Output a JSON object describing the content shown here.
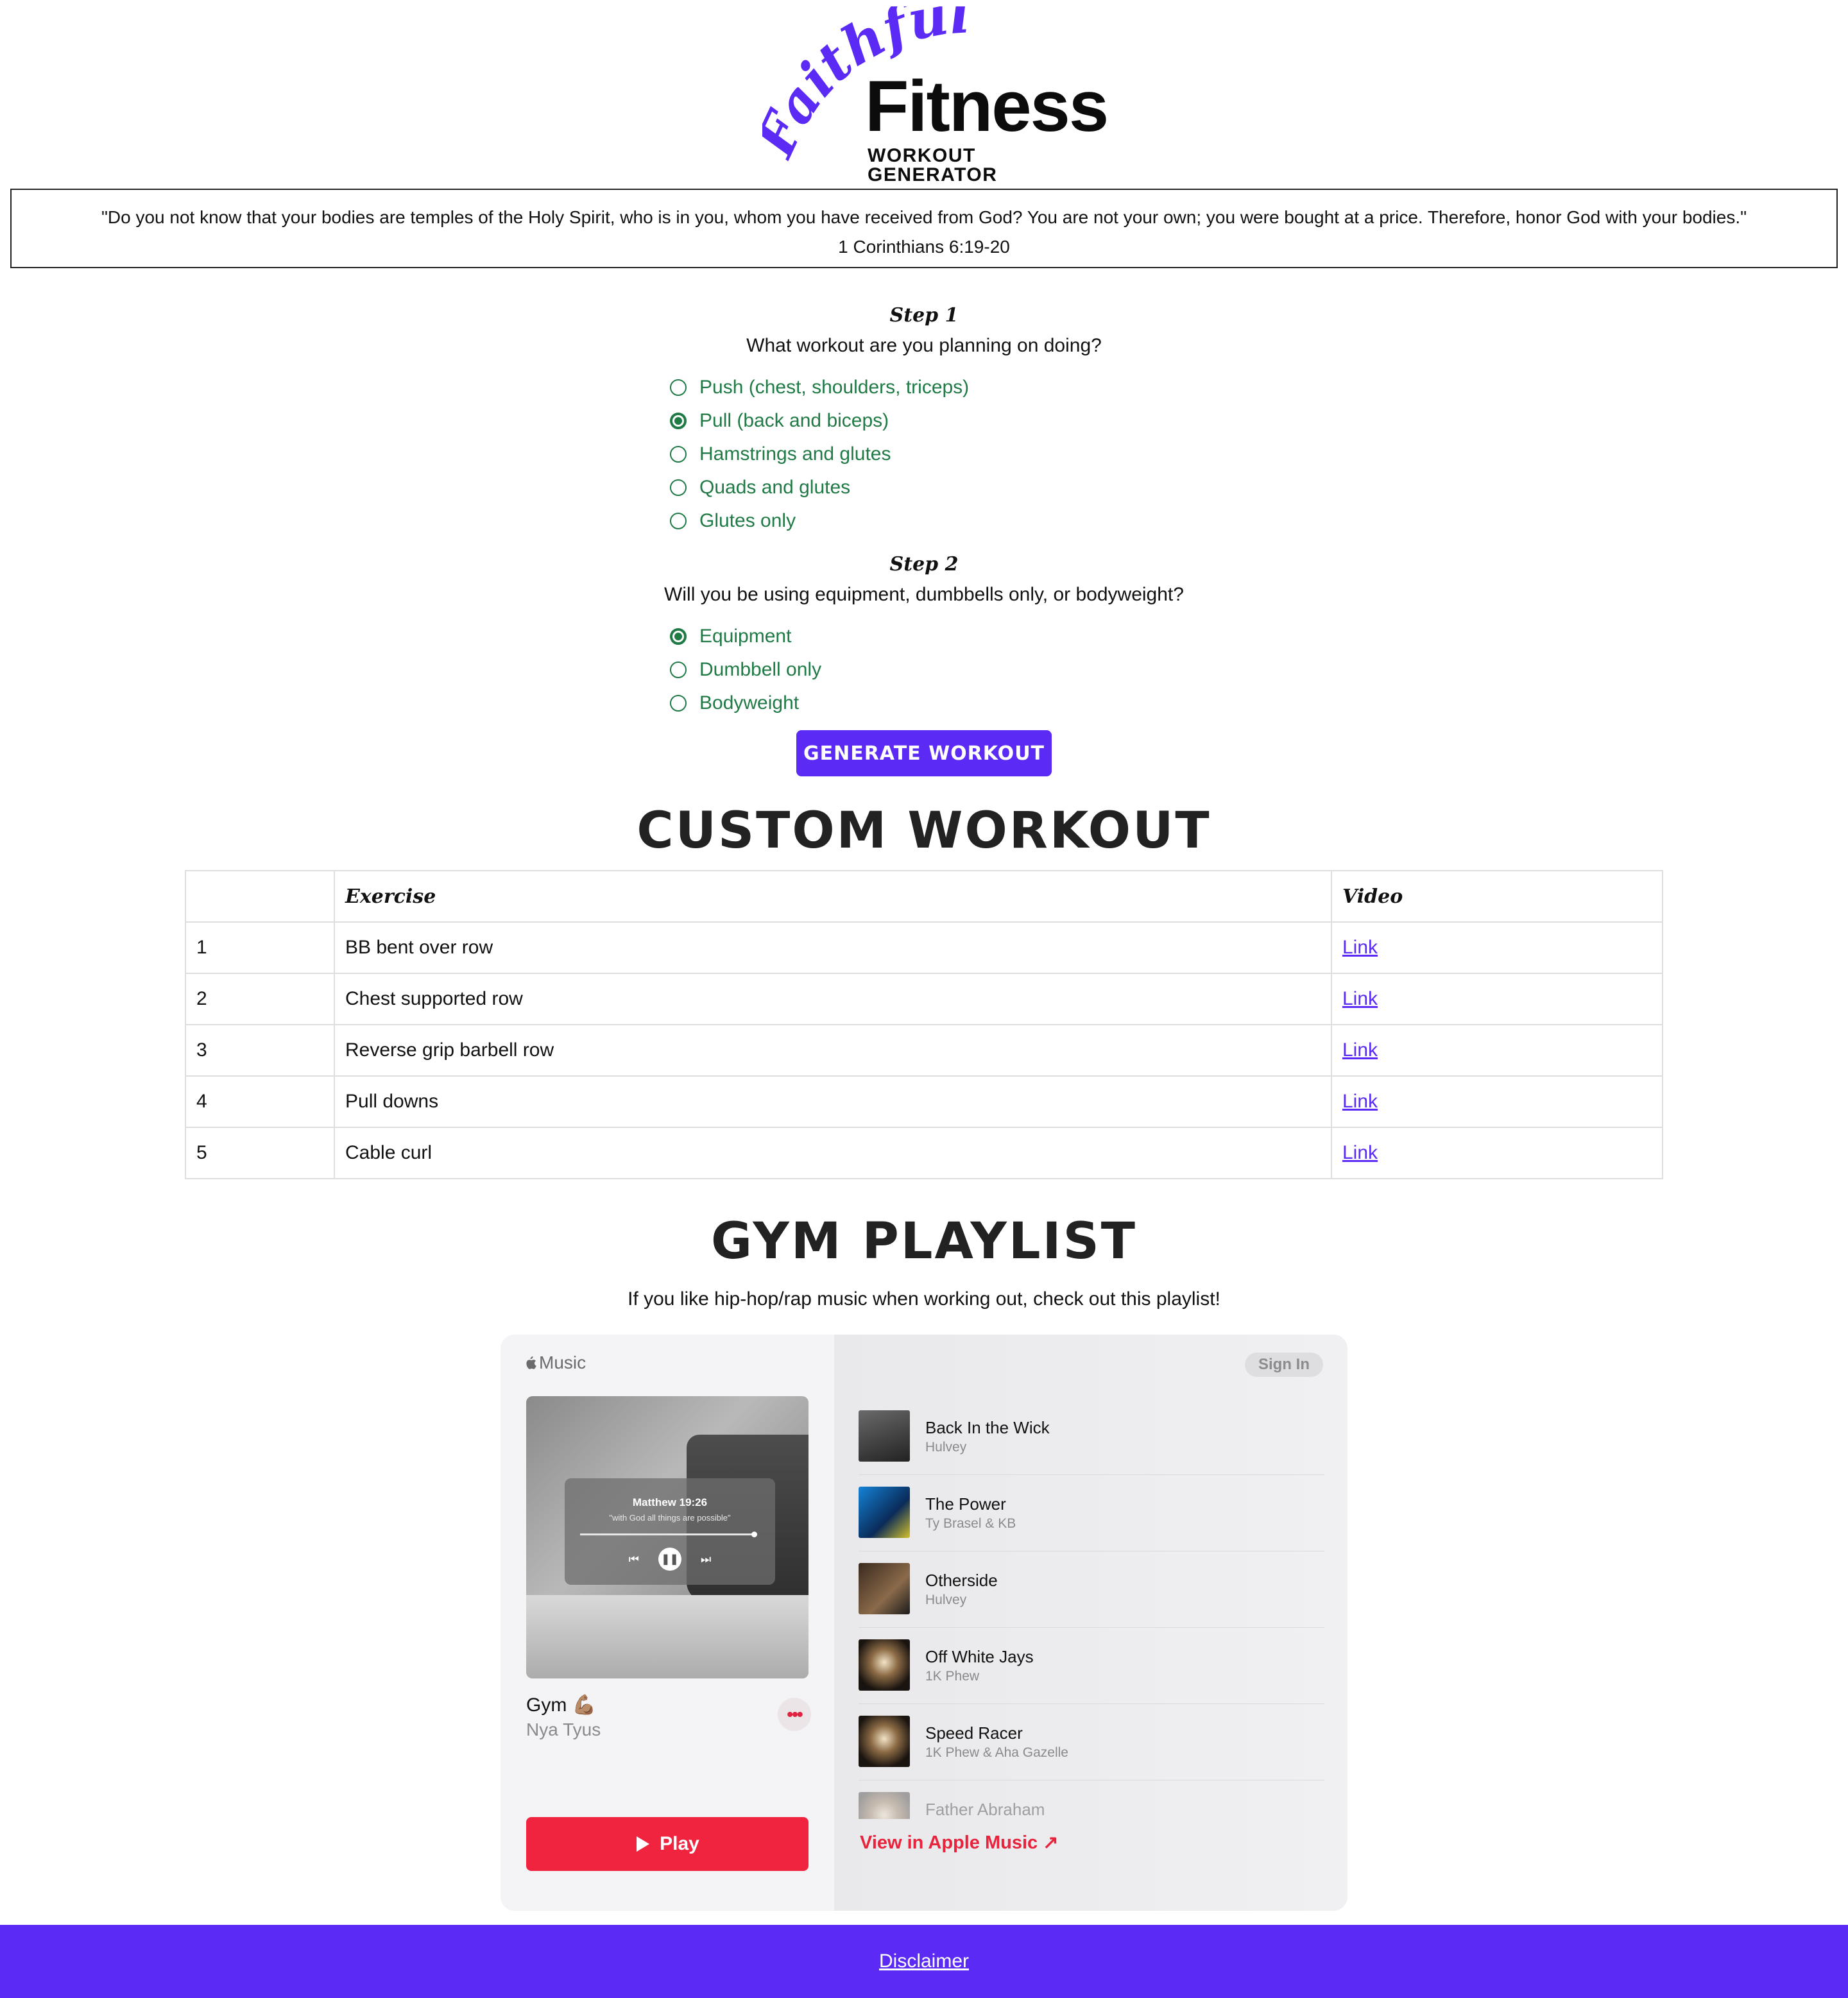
{
  "brand": {
    "script_word": "Faithful",
    "main_word": "Fitness",
    "subtitle": "WORKOUT GENERATOR",
    "accent_color": "#5b2bf5"
  },
  "verse": {
    "text": "\"Do you not know that your bodies are temples of the Holy Spirit, who is in you, whom you have received from God? You are not your own; you were bought at a price. Therefore, honor God with your bodies.\"",
    "reference": "1 Corinthians 6:19-20"
  },
  "step1": {
    "title": "Step 1",
    "question": "What workout are you planning on doing?",
    "options": [
      {
        "label": "Push (chest, shoulders, triceps)",
        "checked": false
      },
      {
        "label": "Pull (back and biceps)",
        "checked": true
      },
      {
        "label": "Hamstrings and glutes",
        "checked": false
      },
      {
        "label": "Quads and glutes",
        "checked": false
      },
      {
        "label": "Glutes only",
        "checked": false
      }
    ]
  },
  "step2": {
    "title": "Step 2",
    "question": "Will you be using equipment, dumbbells only, or bodyweight?",
    "options": [
      {
        "label": "Equipment",
        "checked": true
      },
      {
        "label": "Dumbbell only",
        "checked": false
      },
      {
        "label": "Bodyweight",
        "checked": false
      }
    ]
  },
  "generate_button": "Generate Workout",
  "workout": {
    "heading": "Custom Workout",
    "columns": [
      "",
      "Exercise",
      "Video"
    ],
    "rows": [
      {
        "num": "1",
        "exercise": "BB bent over row",
        "video": "Link"
      },
      {
        "num": "2",
        "exercise": "Chest supported row",
        "video": "Link"
      },
      {
        "num": "3",
        "exercise": "Reverse grip barbell row",
        "video": "Link"
      },
      {
        "num": "4",
        "exercise": "Pull downs",
        "video": "Link"
      },
      {
        "num": "5",
        "exercise": "Cable curl",
        "video": "Link"
      }
    ]
  },
  "playlist": {
    "heading": "Gym Playlist",
    "intro": "If you like hip-hop/rap music when working out, check out this playlist!",
    "embed": {
      "service": "Music",
      "sign_in": "Sign In",
      "cover_title": "Matthew 19:26",
      "cover_subtitle": "\"with God all things are possible\"",
      "name": "Gym 💪🏽",
      "owner": "Nya Tyus",
      "more_label": "•••",
      "play_label": "Play",
      "view_label": "View in Apple Music ↗",
      "play_color": "#f0243f",
      "tracks": [
        {
          "title": "Back In the Wick",
          "artist": "Hulvey"
        },
        {
          "title": "The Power",
          "artist": "Ty Brasel & KB"
        },
        {
          "title": "Otherside",
          "artist": "Hulvey"
        },
        {
          "title": "Off White Jays",
          "artist": "1K Phew"
        },
        {
          "title": "Speed Racer",
          "artist": "1K Phew & Aha Gazelle"
        },
        {
          "title": "Father Abraham",
          "artist": ""
        }
      ]
    }
  },
  "footer": {
    "link": "Disclaimer"
  }
}
